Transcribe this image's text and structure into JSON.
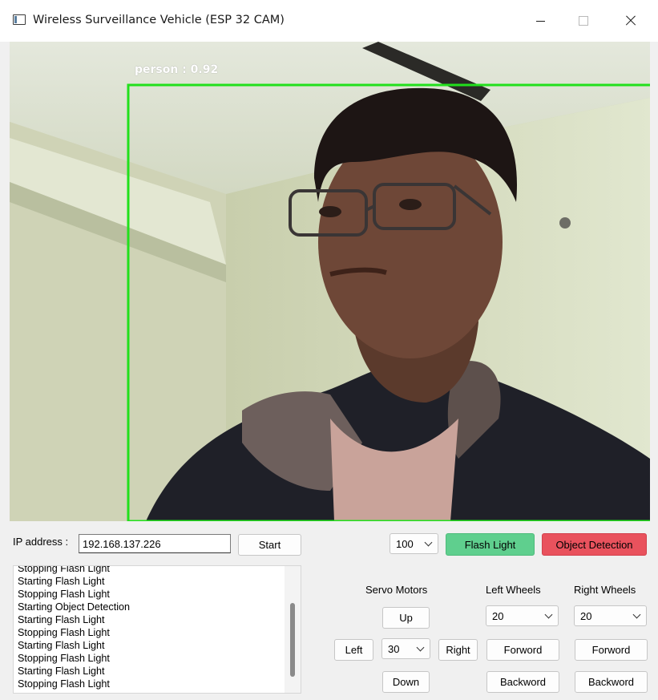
{
  "window": {
    "title": "Wireless Surveillance Vehicle (ESP 32 CAM)"
  },
  "camera": {
    "detection_label": "person : 0.92",
    "box_color": "#22e01c"
  },
  "connection": {
    "ip_label": "IP address :",
    "ip_value": "192.168.137.226",
    "start_label": "Start"
  },
  "flash": {
    "brightness_value": "100",
    "flash_label": "Flash Light",
    "flash_color": "#5fcf8e"
  },
  "object_detection": {
    "label": "Object Detection",
    "color": "#e9525d"
  },
  "log": {
    "lines": [
      "Stopping Flash Light",
      "Starting Flash Light",
      "Stopping Flash Light",
      "Starting Object Detection",
      "Starting Flash Light",
      "Stopping Flash Light",
      "Starting Flash Light",
      "Stopping Flash Light",
      "Starting Flash Light",
      "Stopping Flash Light"
    ]
  },
  "servo": {
    "title": "Servo Motors",
    "up_label": "Up",
    "left_label": "Left",
    "angle_value": "30",
    "right_label": "Right",
    "down_label": "Down"
  },
  "left_wheels": {
    "title": "Left Wheels",
    "speed_value": "20",
    "forward_label": "Forword",
    "backward_label": "Backword"
  },
  "right_wheels": {
    "title": "Right Wheels",
    "speed_value": "20",
    "forward_label": "Forword",
    "backward_label": "Backword"
  }
}
